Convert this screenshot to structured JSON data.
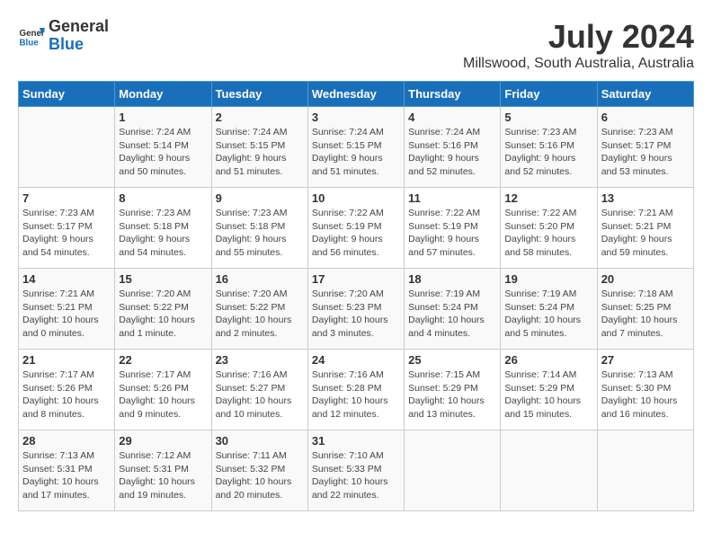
{
  "header": {
    "logo_line1": "General",
    "logo_line2": "Blue",
    "month": "July 2024",
    "location": "Millswood, South Australia, Australia"
  },
  "days_of_week": [
    "Sunday",
    "Monday",
    "Tuesday",
    "Wednesday",
    "Thursday",
    "Friday",
    "Saturday"
  ],
  "weeks": [
    [
      {
        "day": "",
        "info": ""
      },
      {
        "day": "1",
        "info": "Sunrise: 7:24 AM\nSunset: 5:14 PM\nDaylight: 9 hours\nand 50 minutes."
      },
      {
        "day": "2",
        "info": "Sunrise: 7:24 AM\nSunset: 5:15 PM\nDaylight: 9 hours\nand 51 minutes."
      },
      {
        "day": "3",
        "info": "Sunrise: 7:24 AM\nSunset: 5:15 PM\nDaylight: 9 hours\nand 51 minutes."
      },
      {
        "day": "4",
        "info": "Sunrise: 7:24 AM\nSunset: 5:16 PM\nDaylight: 9 hours\nand 52 minutes."
      },
      {
        "day": "5",
        "info": "Sunrise: 7:23 AM\nSunset: 5:16 PM\nDaylight: 9 hours\nand 52 minutes."
      },
      {
        "day": "6",
        "info": "Sunrise: 7:23 AM\nSunset: 5:17 PM\nDaylight: 9 hours\nand 53 minutes."
      }
    ],
    [
      {
        "day": "7",
        "info": "Sunrise: 7:23 AM\nSunset: 5:17 PM\nDaylight: 9 hours\nand 54 minutes."
      },
      {
        "day": "8",
        "info": "Sunrise: 7:23 AM\nSunset: 5:18 PM\nDaylight: 9 hours\nand 54 minutes."
      },
      {
        "day": "9",
        "info": "Sunrise: 7:23 AM\nSunset: 5:18 PM\nDaylight: 9 hours\nand 55 minutes."
      },
      {
        "day": "10",
        "info": "Sunrise: 7:22 AM\nSunset: 5:19 PM\nDaylight: 9 hours\nand 56 minutes."
      },
      {
        "day": "11",
        "info": "Sunrise: 7:22 AM\nSunset: 5:19 PM\nDaylight: 9 hours\nand 57 minutes."
      },
      {
        "day": "12",
        "info": "Sunrise: 7:22 AM\nSunset: 5:20 PM\nDaylight: 9 hours\nand 58 minutes."
      },
      {
        "day": "13",
        "info": "Sunrise: 7:21 AM\nSunset: 5:21 PM\nDaylight: 9 hours\nand 59 minutes."
      }
    ],
    [
      {
        "day": "14",
        "info": "Sunrise: 7:21 AM\nSunset: 5:21 PM\nDaylight: 10 hours\nand 0 minutes."
      },
      {
        "day": "15",
        "info": "Sunrise: 7:20 AM\nSunset: 5:22 PM\nDaylight: 10 hours\nand 1 minute."
      },
      {
        "day": "16",
        "info": "Sunrise: 7:20 AM\nSunset: 5:22 PM\nDaylight: 10 hours\nand 2 minutes."
      },
      {
        "day": "17",
        "info": "Sunrise: 7:20 AM\nSunset: 5:23 PM\nDaylight: 10 hours\nand 3 minutes."
      },
      {
        "day": "18",
        "info": "Sunrise: 7:19 AM\nSunset: 5:24 PM\nDaylight: 10 hours\nand 4 minutes."
      },
      {
        "day": "19",
        "info": "Sunrise: 7:19 AM\nSunset: 5:24 PM\nDaylight: 10 hours\nand 5 minutes."
      },
      {
        "day": "20",
        "info": "Sunrise: 7:18 AM\nSunset: 5:25 PM\nDaylight: 10 hours\nand 7 minutes."
      }
    ],
    [
      {
        "day": "21",
        "info": "Sunrise: 7:17 AM\nSunset: 5:26 PM\nDaylight: 10 hours\nand 8 minutes."
      },
      {
        "day": "22",
        "info": "Sunrise: 7:17 AM\nSunset: 5:26 PM\nDaylight: 10 hours\nand 9 minutes."
      },
      {
        "day": "23",
        "info": "Sunrise: 7:16 AM\nSunset: 5:27 PM\nDaylight: 10 hours\nand 10 minutes."
      },
      {
        "day": "24",
        "info": "Sunrise: 7:16 AM\nSunset: 5:28 PM\nDaylight: 10 hours\nand 12 minutes."
      },
      {
        "day": "25",
        "info": "Sunrise: 7:15 AM\nSunset: 5:29 PM\nDaylight: 10 hours\nand 13 minutes."
      },
      {
        "day": "26",
        "info": "Sunrise: 7:14 AM\nSunset: 5:29 PM\nDaylight: 10 hours\nand 15 minutes."
      },
      {
        "day": "27",
        "info": "Sunrise: 7:13 AM\nSunset: 5:30 PM\nDaylight: 10 hours\nand 16 minutes."
      }
    ],
    [
      {
        "day": "28",
        "info": "Sunrise: 7:13 AM\nSunset: 5:31 PM\nDaylight: 10 hours\nand 17 minutes."
      },
      {
        "day": "29",
        "info": "Sunrise: 7:12 AM\nSunset: 5:31 PM\nDaylight: 10 hours\nand 19 minutes."
      },
      {
        "day": "30",
        "info": "Sunrise: 7:11 AM\nSunset: 5:32 PM\nDaylight: 10 hours\nand 20 minutes."
      },
      {
        "day": "31",
        "info": "Sunrise: 7:10 AM\nSunset: 5:33 PM\nDaylight: 10 hours\nand 22 minutes."
      },
      {
        "day": "",
        "info": ""
      },
      {
        "day": "",
        "info": ""
      },
      {
        "day": "",
        "info": ""
      }
    ]
  ]
}
